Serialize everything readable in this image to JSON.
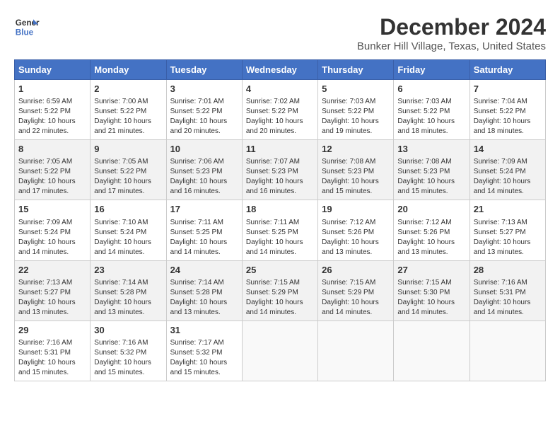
{
  "header": {
    "logo_line1": "General",
    "logo_line2": "Blue",
    "month_title": "December 2024",
    "location": "Bunker Hill Village, Texas, United States"
  },
  "days_of_week": [
    "Sunday",
    "Monday",
    "Tuesday",
    "Wednesday",
    "Thursday",
    "Friday",
    "Saturday"
  ],
  "weeks": [
    [
      {
        "day": "1",
        "info": "Sunrise: 6:59 AM\nSunset: 5:22 PM\nDaylight: 10 hours and 22 minutes."
      },
      {
        "day": "2",
        "info": "Sunrise: 7:00 AM\nSunset: 5:22 PM\nDaylight: 10 hours and 21 minutes."
      },
      {
        "day": "3",
        "info": "Sunrise: 7:01 AM\nSunset: 5:22 PM\nDaylight: 10 hours and 20 minutes."
      },
      {
        "day": "4",
        "info": "Sunrise: 7:02 AM\nSunset: 5:22 PM\nDaylight: 10 hours and 20 minutes."
      },
      {
        "day": "5",
        "info": "Sunrise: 7:03 AM\nSunset: 5:22 PM\nDaylight: 10 hours and 19 minutes."
      },
      {
        "day": "6",
        "info": "Sunrise: 7:03 AM\nSunset: 5:22 PM\nDaylight: 10 hours and 18 minutes."
      },
      {
        "day": "7",
        "info": "Sunrise: 7:04 AM\nSunset: 5:22 PM\nDaylight: 10 hours and 18 minutes."
      }
    ],
    [
      {
        "day": "8",
        "info": "Sunrise: 7:05 AM\nSunset: 5:22 PM\nDaylight: 10 hours and 17 minutes."
      },
      {
        "day": "9",
        "info": "Sunrise: 7:05 AM\nSunset: 5:22 PM\nDaylight: 10 hours and 17 minutes."
      },
      {
        "day": "10",
        "info": "Sunrise: 7:06 AM\nSunset: 5:23 PM\nDaylight: 10 hours and 16 minutes."
      },
      {
        "day": "11",
        "info": "Sunrise: 7:07 AM\nSunset: 5:23 PM\nDaylight: 10 hours and 16 minutes."
      },
      {
        "day": "12",
        "info": "Sunrise: 7:08 AM\nSunset: 5:23 PM\nDaylight: 10 hours and 15 minutes."
      },
      {
        "day": "13",
        "info": "Sunrise: 7:08 AM\nSunset: 5:23 PM\nDaylight: 10 hours and 15 minutes."
      },
      {
        "day": "14",
        "info": "Sunrise: 7:09 AM\nSunset: 5:24 PM\nDaylight: 10 hours and 14 minutes."
      }
    ],
    [
      {
        "day": "15",
        "info": "Sunrise: 7:09 AM\nSunset: 5:24 PM\nDaylight: 10 hours and 14 minutes."
      },
      {
        "day": "16",
        "info": "Sunrise: 7:10 AM\nSunset: 5:24 PM\nDaylight: 10 hours and 14 minutes."
      },
      {
        "day": "17",
        "info": "Sunrise: 7:11 AM\nSunset: 5:25 PM\nDaylight: 10 hours and 14 minutes."
      },
      {
        "day": "18",
        "info": "Sunrise: 7:11 AM\nSunset: 5:25 PM\nDaylight: 10 hours and 14 minutes."
      },
      {
        "day": "19",
        "info": "Sunrise: 7:12 AM\nSunset: 5:26 PM\nDaylight: 10 hours and 13 minutes."
      },
      {
        "day": "20",
        "info": "Sunrise: 7:12 AM\nSunset: 5:26 PM\nDaylight: 10 hours and 13 minutes."
      },
      {
        "day": "21",
        "info": "Sunrise: 7:13 AM\nSunset: 5:27 PM\nDaylight: 10 hours and 13 minutes."
      }
    ],
    [
      {
        "day": "22",
        "info": "Sunrise: 7:13 AM\nSunset: 5:27 PM\nDaylight: 10 hours and 13 minutes."
      },
      {
        "day": "23",
        "info": "Sunrise: 7:14 AM\nSunset: 5:28 PM\nDaylight: 10 hours and 13 minutes."
      },
      {
        "day": "24",
        "info": "Sunrise: 7:14 AM\nSunset: 5:28 PM\nDaylight: 10 hours and 13 minutes."
      },
      {
        "day": "25",
        "info": "Sunrise: 7:15 AM\nSunset: 5:29 PM\nDaylight: 10 hours and 14 minutes."
      },
      {
        "day": "26",
        "info": "Sunrise: 7:15 AM\nSunset: 5:29 PM\nDaylight: 10 hours and 14 minutes."
      },
      {
        "day": "27",
        "info": "Sunrise: 7:15 AM\nSunset: 5:30 PM\nDaylight: 10 hours and 14 minutes."
      },
      {
        "day": "28",
        "info": "Sunrise: 7:16 AM\nSunset: 5:31 PM\nDaylight: 10 hours and 14 minutes."
      }
    ],
    [
      {
        "day": "29",
        "info": "Sunrise: 7:16 AM\nSunset: 5:31 PM\nDaylight: 10 hours and 15 minutes."
      },
      {
        "day": "30",
        "info": "Sunrise: 7:16 AM\nSunset: 5:32 PM\nDaylight: 10 hours and 15 minutes."
      },
      {
        "day": "31",
        "info": "Sunrise: 7:17 AM\nSunset: 5:32 PM\nDaylight: 10 hours and 15 minutes."
      },
      {
        "day": "",
        "info": ""
      },
      {
        "day": "",
        "info": ""
      },
      {
        "day": "",
        "info": ""
      },
      {
        "day": "",
        "info": ""
      }
    ]
  ]
}
